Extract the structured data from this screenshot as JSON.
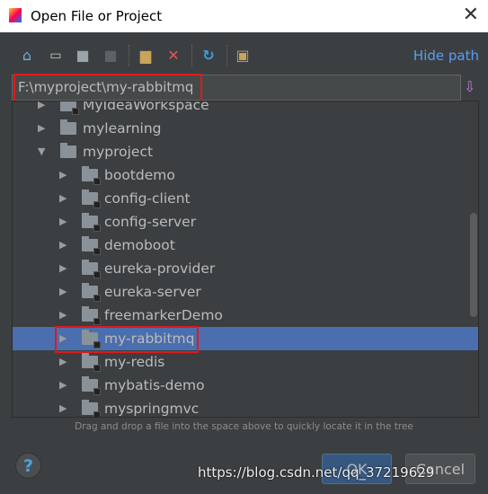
{
  "window": {
    "title": "Open File or Project"
  },
  "toolbar": {
    "hide_path": "Hide path",
    "icons": [
      "home-icon",
      "desktop-icon",
      "project-folder-icon",
      "module-folder-icon",
      "new-folder-icon",
      "delete-icon",
      "refresh-icon",
      "show-hidden-icon"
    ]
  },
  "path": {
    "value": "F:\\myproject\\my-rabbitmq"
  },
  "tree": {
    "rows": [
      {
        "label": "MyIdeaWorkspace",
        "level": 1,
        "expanded": false,
        "module": true
      },
      {
        "label": "mylearning",
        "level": 1,
        "expanded": false,
        "module": false
      },
      {
        "label": "myproject",
        "level": 1,
        "expanded": true,
        "module": false
      },
      {
        "label": "bootdemo",
        "level": 2,
        "expanded": false,
        "module": true
      },
      {
        "label": "config-client",
        "level": 2,
        "expanded": false,
        "module": true
      },
      {
        "label": "config-server",
        "level": 2,
        "expanded": false,
        "module": true
      },
      {
        "label": "demoboot",
        "level": 2,
        "expanded": false,
        "module": true
      },
      {
        "label": "eureka-provider",
        "level": 2,
        "expanded": false,
        "module": true
      },
      {
        "label": "eureka-server",
        "level": 2,
        "expanded": false,
        "module": true
      },
      {
        "label": "freemarkerDemo",
        "level": 2,
        "expanded": false,
        "module": true
      },
      {
        "label": "my-rabbitmq",
        "level": 2,
        "expanded": false,
        "module": true,
        "selected": true
      },
      {
        "label": "my-redis",
        "level": 2,
        "expanded": false,
        "module": true
      },
      {
        "label": "mybatis-demo",
        "level": 2,
        "expanded": false,
        "module": true
      },
      {
        "label": "myspringmvc",
        "level": 2,
        "expanded": false,
        "module": true
      }
    ]
  },
  "hint": "Drag and drop a file into the space above to quickly locate it in the tree",
  "buttons": {
    "help": "?",
    "ok": "OK",
    "cancel": "Cancel"
  },
  "watermark": "https://blog.csdn.net/qq_37219629",
  "colors": {
    "selection": "#4b6eaf",
    "link": "#589df6",
    "highlight_box": "#e0191a"
  }
}
